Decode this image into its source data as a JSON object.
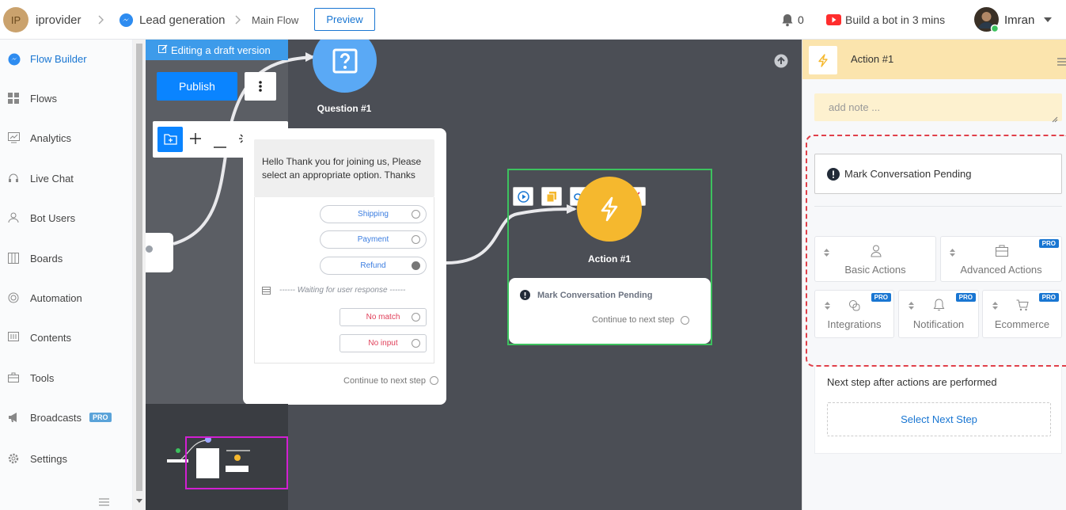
{
  "topbar": {
    "avatar_initials": "IP",
    "account": "iprovider",
    "flow_name": "Lead generation",
    "sub_flow": "Main Flow",
    "preview_label": "Preview",
    "notifications_count": "0",
    "promo_label": "Build a bot in 3 mins",
    "user_name": "Imran"
  },
  "sidebar": {
    "items": [
      {
        "label": "Flow Builder",
        "icon": "messenger-icon"
      },
      {
        "label": "Flows",
        "icon": "grid-icon"
      },
      {
        "label": "Analytics",
        "icon": "chart-icon"
      },
      {
        "label": "Live Chat",
        "icon": "headset-icon"
      },
      {
        "label": "Bot Users",
        "icon": "user-icon"
      },
      {
        "label": "Boards",
        "icon": "board-icon"
      },
      {
        "label": "Automation",
        "icon": "automation-icon"
      },
      {
        "label": "Contents",
        "icon": "contents-icon"
      },
      {
        "label": "Tools",
        "icon": "toolbox-icon"
      },
      {
        "label": "Broadcasts",
        "icon": "megaphone-icon"
      },
      {
        "label": "Settings",
        "icon": "gear-icon"
      }
    ],
    "pro_badge": "PRO"
  },
  "canvas": {
    "draft_banner": "Editing a draft version",
    "publish_label": "Publish",
    "question_node_title": "Question #1",
    "question_message": "Hello  Thank you for joining us, Please select an appropriate option. Thanks",
    "options": [
      "Shipping",
      "Payment",
      "Refund"
    ],
    "waiting_text": "------ Waiting for user response ------",
    "no_match": "No match",
    "no_input": "No input",
    "continue_label": "Continue to next step",
    "action_node_title": "Action #1",
    "action_item": "Mark Conversation Pending",
    "action_continue": "Continue to next step"
  },
  "panel": {
    "title": "Action #1",
    "note_placeholder": "add note ...",
    "selected_action": "Mark Conversation Pending",
    "categories": [
      {
        "label": "Basic Actions",
        "pro": false
      },
      {
        "label": "Advanced Actions",
        "pro": true
      },
      {
        "label": "Integrations",
        "pro": true
      },
      {
        "label": "Notification",
        "pro": true
      },
      {
        "label": "Ecommerce",
        "pro": true
      }
    ],
    "pro_label": "PRO",
    "next_step_label": "Next step after actions are performed",
    "select_next_step": "Select Next Step"
  },
  "colors": {
    "accent": "#1976d2",
    "canvas_bg": "#4b4e55",
    "action_yellow": "#f5b82e",
    "question_blue": "#5aa9f5",
    "selection_green": "#3cc25e",
    "minimap_frame": "#d21fd2",
    "panel_header": "#fbe4ad",
    "dashed_red": "#e0404a"
  }
}
